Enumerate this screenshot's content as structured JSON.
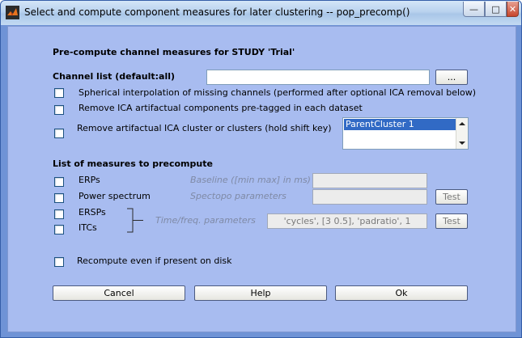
{
  "window": {
    "title": "Select and compute component measures for later clustering -- pop_precomp()",
    "icons": {
      "app": "matlab-icon",
      "minimize": "minimize-icon",
      "maximize": "maximize-icon",
      "close": "close-icon"
    },
    "colors": {
      "frame": "#6f93d6",
      "panel": "#a8bcf0",
      "selection": "#316ac5"
    }
  },
  "header": {
    "title": "Pre-compute channel measures for STUDY 'Trial'"
  },
  "channel_list": {
    "label": "Channel list (default:all)",
    "value": "",
    "browse_label": "..."
  },
  "options": {
    "interp_label": "Spherical interpolation of missing channels (performed after optional ICA removal below)",
    "remove_ica_label": "Remove ICA artifactual components pre-tagged in each dataset",
    "remove_cluster_label": "Remove artifactual ICA cluster or clusters (hold shift key)",
    "cluster_list": [
      "ParentCluster 1"
    ]
  },
  "measures": {
    "section_title": "List of measures to precompute",
    "erps_label": "ERPs",
    "baseline_label": "Baseline ([min max] in ms)",
    "baseline_value": "",
    "power_label": "Power spectrum",
    "spectopo_label": "Spectopo parameters",
    "spectopo_value": "",
    "spec_test_label": "Test",
    "ersps_label": "ERSPs",
    "itcs_label": "ITCs",
    "timefreq_label": "Time/freq. parameters",
    "timefreq_value": "'cycles', [3 0.5], 'padratio', 1",
    "tf_test_label": "Test"
  },
  "recompute": {
    "label": "Recompute even if present on disk"
  },
  "footer": {
    "cancel_label": "Cancel",
    "help_label": "Help",
    "ok_label": "Ok"
  }
}
